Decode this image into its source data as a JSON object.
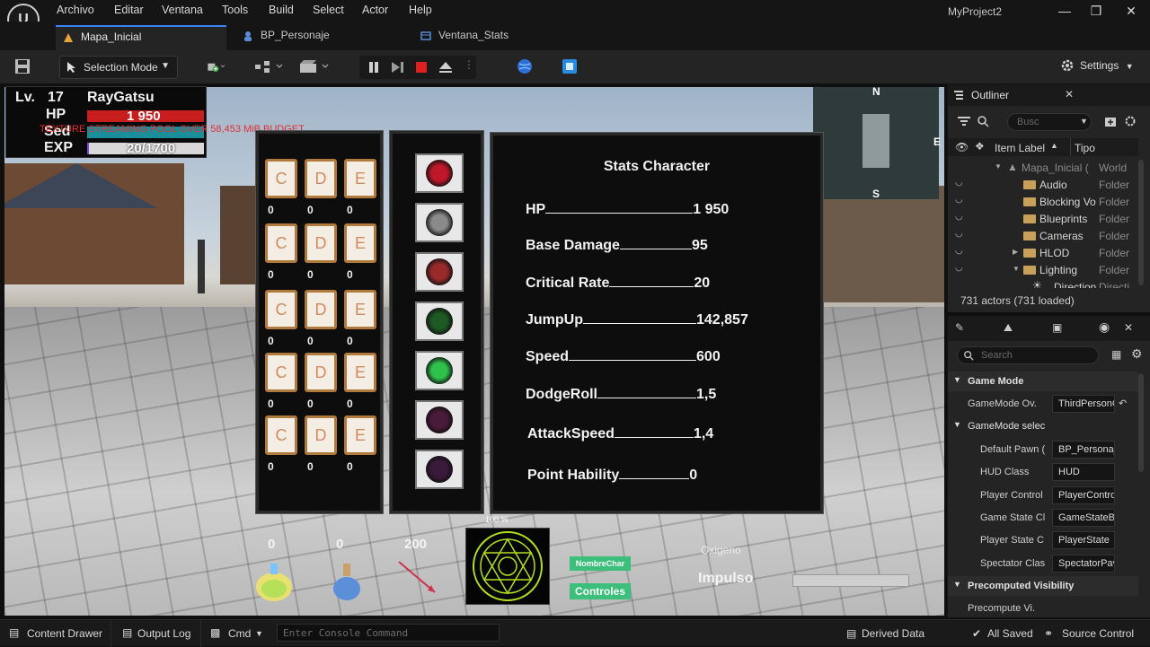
{
  "menubar": {
    "items": [
      "Archivo",
      "Editar",
      "Ventana",
      "Tools",
      "Build",
      "Select",
      "Actor",
      "Help"
    ],
    "project": "MyProject2"
  },
  "tabs": [
    {
      "label": "Mapa_Inicial",
      "active": true
    },
    {
      "label": "BP_Personaje",
      "active": false
    },
    {
      "label": "Ventana_Stats",
      "active": false
    }
  ],
  "toolbar": {
    "selection_mode": "Selection Mode",
    "settings": "Settings"
  },
  "hud": {
    "lv_label": "Lv.",
    "level": "17",
    "name": "RayGatsu",
    "hp_label": "HP",
    "hp_value": "1 950",
    "stamina_label": "Sed",
    "exp_label": "EXP",
    "exp_value": "20/1700",
    "exp_fraction": 0.0118,
    "streaming_warning": "TEXTURE STREAMING POOL OVER 58,453 MiB BUDGET"
  },
  "inventory": {
    "slots": [
      {
        "letter": "C",
        "count": "0"
      },
      {
        "letter": "D",
        "count": "0"
      },
      {
        "letter": "E",
        "count": "0"
      },
      {
        "letter": "C",
        "count": "0"
      },
      {
        "letter": "D",
        "count": "0"
      },
      {
        "letter": "E",
        "count": "0"
      },
      {
        "letter": "C",
        "count": "0"
      },
      {
        "letter": "D",
        "count": "0"
      },
      {
        "letter": "E",
        "count": "0"
      },
      {
        "letter": "C",
        "count": "0"
      },
      {
        "letter": "D",
        "count": "0"
      },
      {
        "letter": "E",
        "count": "0"
      },
      {
        "letter": "C",
        "count": "0"
      },
      {
        "letter": "D",
        "count": "0"
      },
      {
        "letter": "E",
        "count": "0"
      }
    ]
  },
  "equipment": [
    {
      "icon": "heart-icon",
      "color": "#c0182a"
    },
    {
      "icon": "crossed-swords-icon",
      "color": "#8a8a8a"
    },
    {
      "icon": "potion-icon",
      "color": "#9a2a2a"
    },
    {
      "icon": "shield-icon",
      "color": "#1d5a24"
    },
    {
      "icon": "running-man-icon",
      "color": "#2fc24a"
    },
    {
      "icon": "dark-emblem-icon",
      "color": "#4a1a3a"
    },
    {
      "icon": "crystal-icon",
      "color": "#3a1a3a"
    }
  ],
  "stats": {
    "title": "Stats Character",
    "rows": [
      {
        "label": "HP",
        "value": "1 950"
      },
      {
        "label": "Base Damage",
        "value": "95"
      },
      {
        "label": "Critical Rate",
        "value": "20"
      },
      {
        "label": "JumpUp",
        "value": "142,857"
      },
      {
        "label": "Speed",
        "value": "600"
      },
      {
        "label": "DodgeRoll",
        "value": "1,5"
      },
      {
        "label": "AttackSpeed",
        "value": "1,4"
      },
      {
        "label": "Point Hability",
        "value": "0"
      }
    ]
  },
  "bottom_hud": {
    "count_a": "0",
    "count_b": "0",
    "count_c": "200",
    "percent": "100 %",
    "nombre_char": "NombreChar",
    "controles": "Controles",
    "oxigeno": "Oxigeno",
    "impulso": "Impulso"
  },
  "minimap": {
    "n": "N",
    "e": "E",
    "s": "S"
  },
  "outliner": {
    "title": "Outliner",
    "search_placeholder": "Busc",
    "col_label": "Item Label",
    "col_type": "Tipo",
    "rows": [
      {
        "label": "Mapa_Inicial (",
        "type": "World"
      },
      {
        "label": "Audio",
        "type": "Folder"
      },
      {
        "label": "Blocking Vo",
        "type": "Folder"
      },
      {
        "label": "Blueprints",
        "type": "Folder"
      },
      {
        "label": "Cameras",
        "type": "Folder"
      },
      {
        "label": "HLOD",
        "type": "Folder"
      },
      {
        "label": "Lighting",
        "type": "Folder"
      },
      {
        "label": "Direction",
        "type": "Directi"
      }
    ],
    "actors": "731 actors (731 loaded)"
  },
  "details": {
    "search_placeholder": "Search",
    "sections": {
      "game_mode": "Game Mode",
      "game_mode_selected": "GameMode selec",
      "precomputed": "Precomputed Visibility"
    },
    "gamemode_override": {
      "label": "GameMode Ov...",
      "value": "ThirdPersonG"
    },
    "rows": [
      {
        "label": "Default Pawn (",
        "value": "BP_Personaje"
      },
      {
        "label": "HUD Class",
        "value": "HUD"
      },
      {
        "label": "Player Control",
        "value": "PlayerControl"
      },
      {
        "label": "Game State Cl",
        "value": "GameStateBa"
      },
      {
        "label": "Player State C",
        "value": "PlayerState"
      },
      {
        "label": "Spectator Clas",
        "value": "SpectatorPav"
      }
    ],
    "precompute_row": "Precompute Vi..."
  },
  "statusbar": {
    "content_drawer": "Content Drawer",
    "output_log": "Output Log",
    "cmd": "Cmd",
    "console_placeholder": "Enter Console Command",
    "derived_data": "Derived Data",
    "all_saved": "All Saved",
    "source_control": "Source Control"
  }
}
